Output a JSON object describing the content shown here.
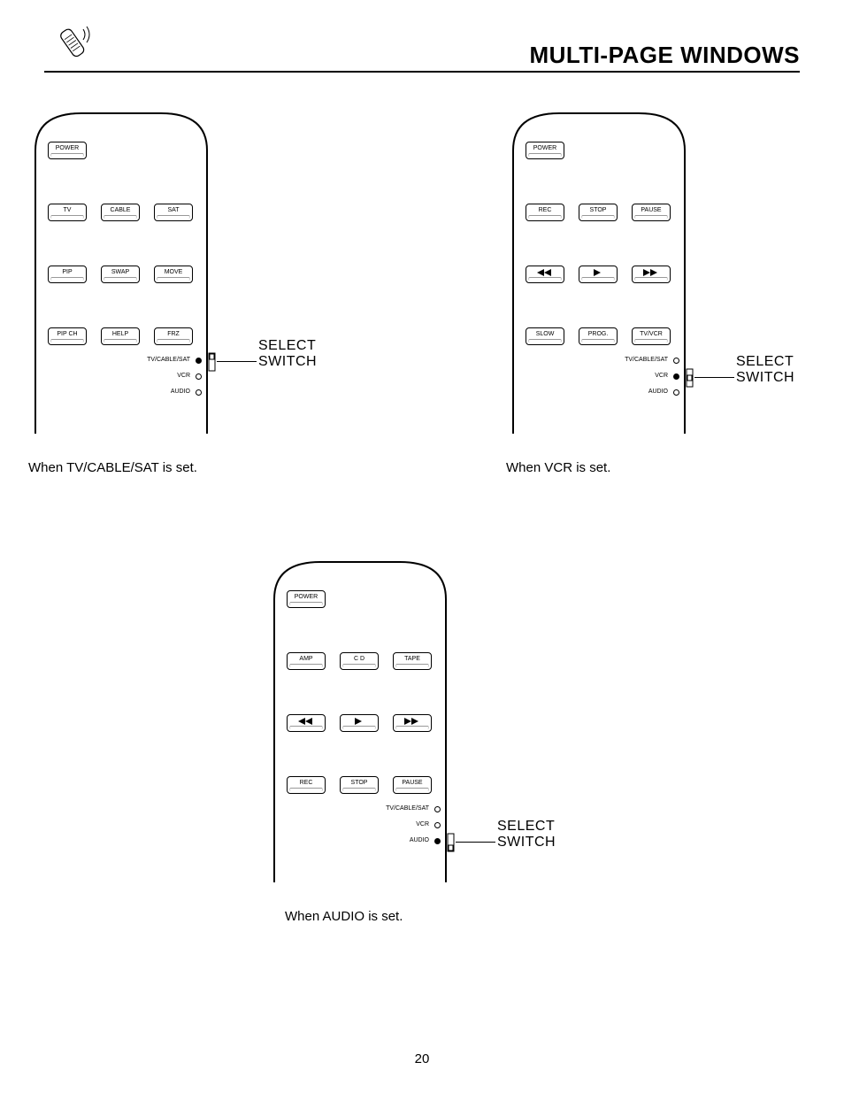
{
  "header": {
    "title": "MULTI-PAGE WINDOWS"
  },
  "labels": {
    "select": "SELECT",
    "switch": "SWITCH",
    "power": "POWER",
    "tv_cable_sat": "TV/CABLE/SAT",
    "vcr": "VCR",
    "audio": "AUDIO"
  },
  "remotes": [
    {
      "id": "tv",
      "caption": "When  TV/CABLE/SAT  is set.",
      "rows": [
        [
          {
            "t": "TV"
          },
          {
            "t": "CABLE"
          },
          {
            "t": "SAT"
          }
        ],
        [
          {
            "t": "PIP"
          },
          {
            "t": "SWAP"
          },
          {
            "t": "MOVE"
          }
        ],
        [
          {
            "t": "PIP CH"
          },
          {
            "t": "HELP"
          },
          {
            "t": "FRZ"
          }
        ]
      ],
      "active": "tv_cable_sat",
      "switchPos": 0
    },
    {
      "id": "vcr",
      "caption": "When  VCR  is set.",
      "rows": [
        [
          {
            "t": "REC"
          },
          {
            "t": "STOP"
          },
          {
            "t": "PAUSE"
          }
        ],
        [
          {
            "icon": "rew"
          },
          {
            "icon": "play"
          },
          {
            "icon": "ff"
          }
        ],
        [
          {
            "t": "SLOW"
          },
          {
            "t": "PROG."
          },
          {
            "t": "TV/VCR"
          }
        ]
      ],
      "active": "vcr",
      "switchPos": 1
    },
    {
      "id": "audio",
      "caption": "When  AUDIO  is set.",
      "rows": [
        [
          {
            "t": "AMP"
          },
          {
            "t": "C D"
          },
          {
            "t": "TAPE"
          }
        ],
        [
          {
            "icon": "rew"
          },
          {
            "icon": "play"
          },
          {
            "icon": "ff"
          }
        ],
        [
          {
            "t": "REC"
          },
          {
            "t": "STOP"
          },
          {
            "t": "PAUSE"
          }
        ]
      ],
      "active": "audio",
      "switchPos": 2
    }
  ],
  "page_number": "20"
}
